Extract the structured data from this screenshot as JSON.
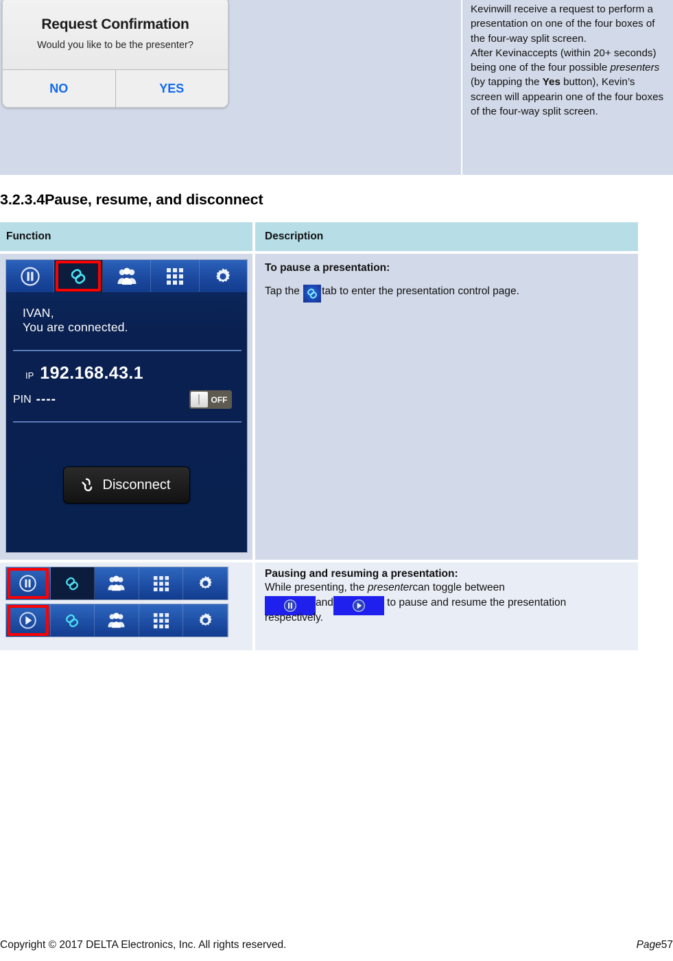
{
  "top_table": {
    "dialog": {
      "title": "Request Confirmation",
      "message": "Would you like to be the presenter?",
      "button_no": "NO",
      "button_yes": "YES"
    },
    "description": {
      "para1": "Kevinwill receive a request to perform a presentation on one of the four boxes of the four-way split screen.",
      "para2_a": "After Kevinaccepts (within 20+ seconds) being one of the four possible ",
      "para2_italic": "presenters",
      "para2_b": " (by tapping the ",
      "para2_bold": "Yes",
      "para2_c": " button), Kevin’s screen will appearin one of the four boxes of the four-way split screen."
    }
  },
  "section": {
    "number": "3.2.3.4",
    "title": "Pause, resume, and disconnect"
  },
  "table": {
    "headers": {
      "function": "Function",
      "description": "Description"
    },
    "row1": {
      "app": {
        "toolbar": [
          {
            "icon": "pause-icon",
            "name": "pause",
            "highlighted": false,
            "dark": false
          },
          {
            "icon": "link-icon",
            "name": "link",
            "highlighted": true,
            "dark": true
          },
          {
            "icon": "people-icon",
            "name": "people",
            "highlighted": false,
            "dark": false
          },
          {
            "icon": "grid-icon",
            "name": "grid",
            "highlighted": false,
            "dark": false
          },
          {
            "icon": "gear-icon",
            "name": "gear",
            "highlighted": false,
            "dark": false
          }
        ],
        "greeting_name": "IVAN,",
        "greeting_status": "You are connected.",
        "ip_label": "IP",
        "ip_value": "192.168.43.1",
        "pin_label": "PIN",
        "pin_value": "----",
        "toggle_state": "OFF",
        "disconnect_label": "Disconnect"
      },
      "desc_title": "To pause a presentation:",
      "desc_part1": "Tap the ",
      "desc_inline_icon": "link-icon",
      "desc_part2": "tab to enter the presentation control page."
    },
    "row2": {
      "toolbars": [
        {
          "name": "toolbar-pause-state",
          "items": [
            {
              "icon": "pause-icon",
              "highlighted": true,
              "dark": false
            },
            {
              "icon": "link-icon",
              "highlighted": false,
              "dark": true
            },
            {
              "icon": "people-icon",
              "highlighted": false,
              "dark": false
            },
            {
              "icon": "grid-icon",
              "highlighted": false,
              "dark": false
            },
            {
              "icon": "gear-icon",
              "highlighted": false,
              "dark": false
            }
          ]
        },
        {
          "name": "toolbar-play-state",
          "items": [
            {
              "icon": "play-icon",
              "highlighted": true,
              "dark": false
            },
            {
              "icon": "link-icon",
              "highlighted": false,
              "dark": false
            },
            {
              "icon": "people-icon",
              "highlighted": false,
              "dark": false
            },
            {
              "icon": "grid-icon",
              "highlighted": false,
              "dark": false
            },
            {
              "icon": "gear-icon",
              "highlighted": false,
              "dark": false
            }
          ]
        }
      ],
      "desc_title": "Pausing and resuming a presentation:",
      "desc_line1_a": "While presenting, the ",
      "desc_line1_italic": "presenter",
      "desc_line1_b": "can toggle between",
      "desc_line2_and": "and",
      "desc_line2_tail": " to pause and resume the presentation respectively."
    }
  },
  "footer": {
    "copyright": "Copyright © 2017 DELTA Electronics, Inc. All rights reserved.",
    "page_word": "Page",
    "page_number": "57"
  },
  "colors": {
    "table_header_bg": "#b7dde7",
    "row1_bg": "#d2d9e8",
    "row2_bg": "#e9edf5",
    "highlight_red": "#fd0000",
    "app_blue": "#1e4da4"
  }
}
